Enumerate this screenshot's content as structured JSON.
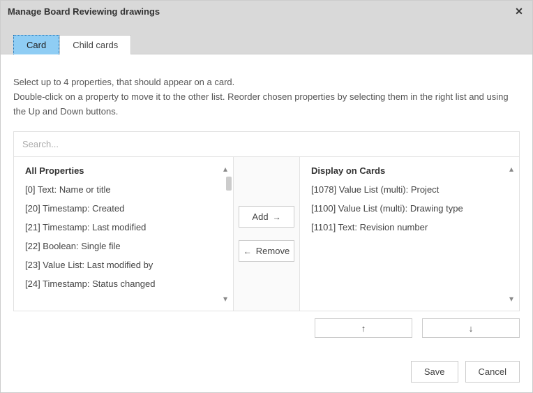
{
  "window": {
    "title": "Manage Board Reviewing drawings"
  },
  "tabs": {
    "card": "Card",
    "child": "Child cards"
  },
  "instructions": {
    "line1": "Select up to 4 properties, that should appear on a card.",
    "line2": "Double-click on a property to move it to the other list. Reorder chosen properties by selecting them in the right list and using the Up and Down buttons."
  },
  "search": {
    "placeholder": "Search..."
  },
  "left": {
    "title": "All Properties",
    "items": [
      "[0] Text: Name or title",
      "[20] Timestamp: Created",
      "[21] Timestamp: Last modified",
      "[22] Boolean: Single file",
      "[23] Value List: Last modified by",
      "[24] Timestamp: Status changed"
    ]
  },
  "middle": {
    "add": "Add",
    "remove": "Remove"
  },
  "right": {
    "title": "Display on Cards",
    "items": [
      "[1078] Value List (multi): Project",
      "[1100] Value List (multi): Drawing type",
      "[1101] Text: Revision number"
    ]
  },
  "reorder": {
    "up": "↑",
    "down": "↓"
  },
  "footer": {
    "save": "Save",
    "cancel": "Cancel"
  }
}
